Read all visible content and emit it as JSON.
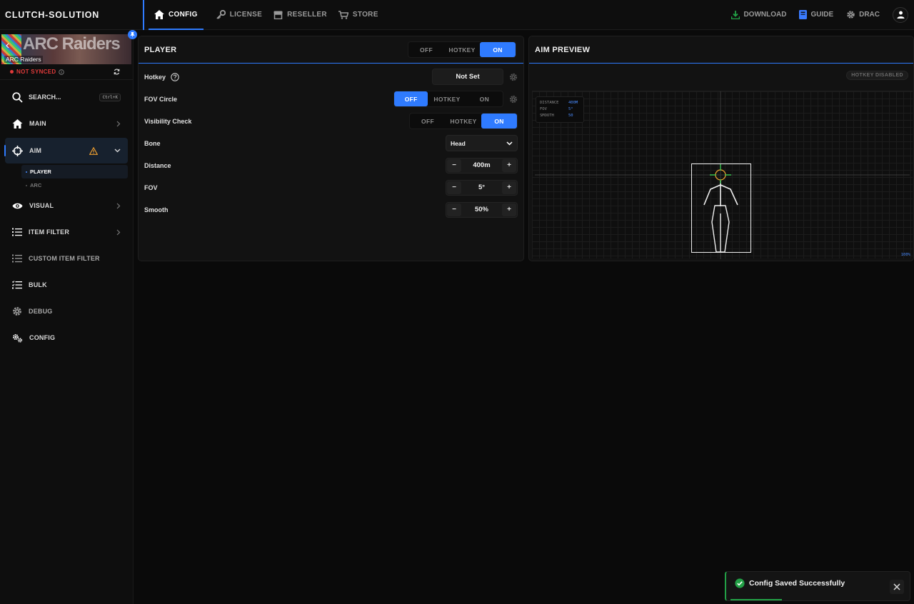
{
  "app": {
    "brand": "CLUTCH-SOLUTION"
  },
  "topnav": {
    "tabs": [
      {
        "label": "CONFIG",
        "icon": "home-icon",
        "active": true
      },
      {
        "label": "LICENSE",
        "icon": "key-icon"
      },
      {
        "label": "RESELLER",
        "icon": "store-icon"
      },
      {
        "label": "STORE",
        "icon": "cart-icon"
      }
    ],
    "right": {
      "download": "DOWNLOAD",
      "guide": "GUIDE",
      "user": "DRAC"
    }
  },
  "sidebar": {
    "game": {
      "logo": "ARC Raiders",
      "name": "ARC Raiders"
    },
    "sync_status": "NOT SYNCED",
    "search": {
      "label": "SEARCH...",
      "shortcut": "Ctrl+K"
    },
    "items": [
      {
        "label": "MAIN",
        "icon": "home-icon"
      },
      {
        "label": "AIM",
        "icon": "crosshair-icon",
        "active": true,
        "warning": true
      },
      {
        "label": "VISUAL",
        "icon": "eye-icon"
      },
      {
        "label": "ITEM FILTER",
        "icon": "list-icon"
      },
      {
        "label": "CUSTOM ITEM FILTER",
        "icon": "list-icon"
      },
      {
        "label": "BULK",
        "icon": "checklist-icon"
      },
      {
        "label": "DEBUG",
        "icon": "gear-icon"
      },
      {
        "label": "CONFIG",
        "icon": "gears-icon"
      }
    ],
    "aim_sub": [
      {
        "label": "PLAYER",
        "active": true
      },
      {
        "label": "ARC"
      }
    ]
  },
  "player_panel": {
    "title": "PLAYER",
    "toggle": {
      "options": [
        "OFF",
        "HOTKEY",
        "ON"
      ],
      "selected": "ON"
    },
    "rows": {
      "hotkey": {
        "label": "Hotkey",
        "value": "Not Set"
      },
      "fov_circle": {
        "label": "FOV Circle",
        "options": [
          "OFF",
          "HOTKEY",
          "ON"
        ],
        "selected": "OFF"
      },
      "visibility_check": {
        "label": "Visibility Check",
        "options": [
          "OFF",
          "HOTKEY",
          "ON"
        ],
        "selected": "ON"
      },
      "bone": {
        "label": "Bone",
        "value": "Head"
      },
      "distance": {
        "label": "Distance",
        "value": "400m"
      },
      "fov": {
        "label": "FOV",
        "value": "5°"
      },
      "smooth": {
        "label": "Smooth",
        "value": "50%"
      }
    }
  },
  "preview_panel": {
    "title": "AIM PREVIEW",
    "badge": "HOTKEY DISABLED",
    "stats": [
      {
        "label": "DISTANCE",
        "value": "400M"
      },
      {
        "label": "FOV",
        "value": "5°"
      },
      {
        "label": "SMOOTH",
        "value": "50"
      }
    ],
    "zoom": "100%"
  },
  "toast": {
    "message": "Config Saved Successfully"
  },
  "colors": {
    "accent": "#2f7bff",
    "success": "#22a046",
    "danger": "#e03a3a",
    "warning": "#f0a030"
  }
}
